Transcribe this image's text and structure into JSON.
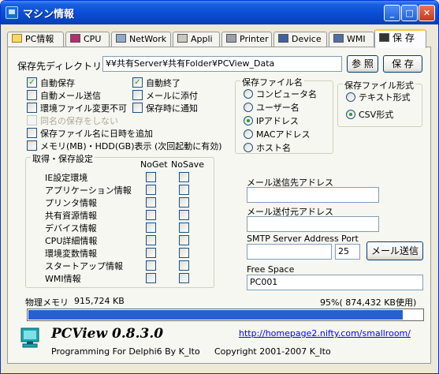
{
  "window": {
    "title": "マシン情報"
  },
  "tabs": [
    {
      "label": "PC情報"
    },
    {
      "label": "CPU"
    },
    {
      "label": "NetWork"
    },
    {
      "label": "Appli"
    },
    {
      "label": "Printer"
    },
    {
      "label": "Device"
    },
    {
      "label": "WMI"
    },
    {
      "label": "保 存"
    }
  ],
  "save": {
    "dir_label": "保存先ディレクトリ",
    "dir_value": "¥¥共有Server¥共有Folder¥PCView_Data",
    "browse_button": "参 照",
    "save_button": "保 存"
  },
  "options": [
    {
      "label": "自動保存",
      "checked": true,
      "disabled": false
    },
    {
      "label": "自動メール送信",
      "checked": false,
      "disabled": false
    },
    {
      "label": "環境ファイル変更不可",
      "checked": false,
      "disabled": false
    },
    {
      "label": "同名の保存をしない",
      "checked": false,
      "disabled": true
    },
    {
      "label": "保存ファイル名に日時を追加",
      "checked": false,
      "disabled": false
    },
    {
      "label": "メモリ(MB)・HDD(GB)表示 (次回起動に有効)",
      "checked": false,
      "disabled": false
    }
  ],
  "options_right": [
    {
      "label": "自動終了",
      "checked": true
    },
    {
      "label": "メールに添付",
      "checked": false
    },
    {
      "label": "保存時に通知",
      "checked": false
    }
  ],
  "filename_group": {
    "title": "保存ファイル名",
    "options": [
      "コンピュータ名",
      "ユーザー名",
      "IPアドレス",
      "MACアドレス",
      "ホスト名"
    ],
    "selected": "IPアドレス"
  },
  "format_group": {
    "title": "保存ファイル形式",
    "options": [
      "テキスト形式",
      "CSV形式"
    ],
    "selected": "CSV形式"
  },
  "acquire_group": {
    "title": "取得・保存設定",
    "col_noget": "NoGet",
    "col_nosave": "NoSave",
    "rows": [
      "IE設定環境",
      "アプリケーション情報",
      "プリンタ情報",
      "共有資源情報",
      "デバイス情報",
      "CPU詳細情報",
      "環境変数情報",
      "スタートアップ情報",
      "WMI情報"
    ]
  },
  "mail": {
    "to_label": "メール送信先アドレス",
    "to_value": "",
    "from_label": "メール送付元アドレス",
    "from_value": "",
    "smtp_label": "SMTP Server Address",
    "smtp_value": "",
    "port_label": "Port",
    "port_value": "25",
    "send_button": "メール送信"
  },
  "free_space": {
    "label": "Free Space",
    "value": "PC001"
  },
  "memory": {
    "label": "物理メモリ",
    "total": "915,724 KB",
    "usage_text": "95%( 874,432 KB使用)",
    "percent": 95
  },
  "footer": {
    "product": "PCView  0.8.3.0",
    "credit": "Programming For Delphi6 By K_Ito",
    "url": "http://homepage2.nifty.com/smallroom/",
    "copyright": "Copyright 2001-2007 K_Ito"
  },
  "colors": {
    "titlebar": "#0a4fd6",
    "progress": "#2660d2",
    "active_tab_accent": "#ffc83c"
  }
}
